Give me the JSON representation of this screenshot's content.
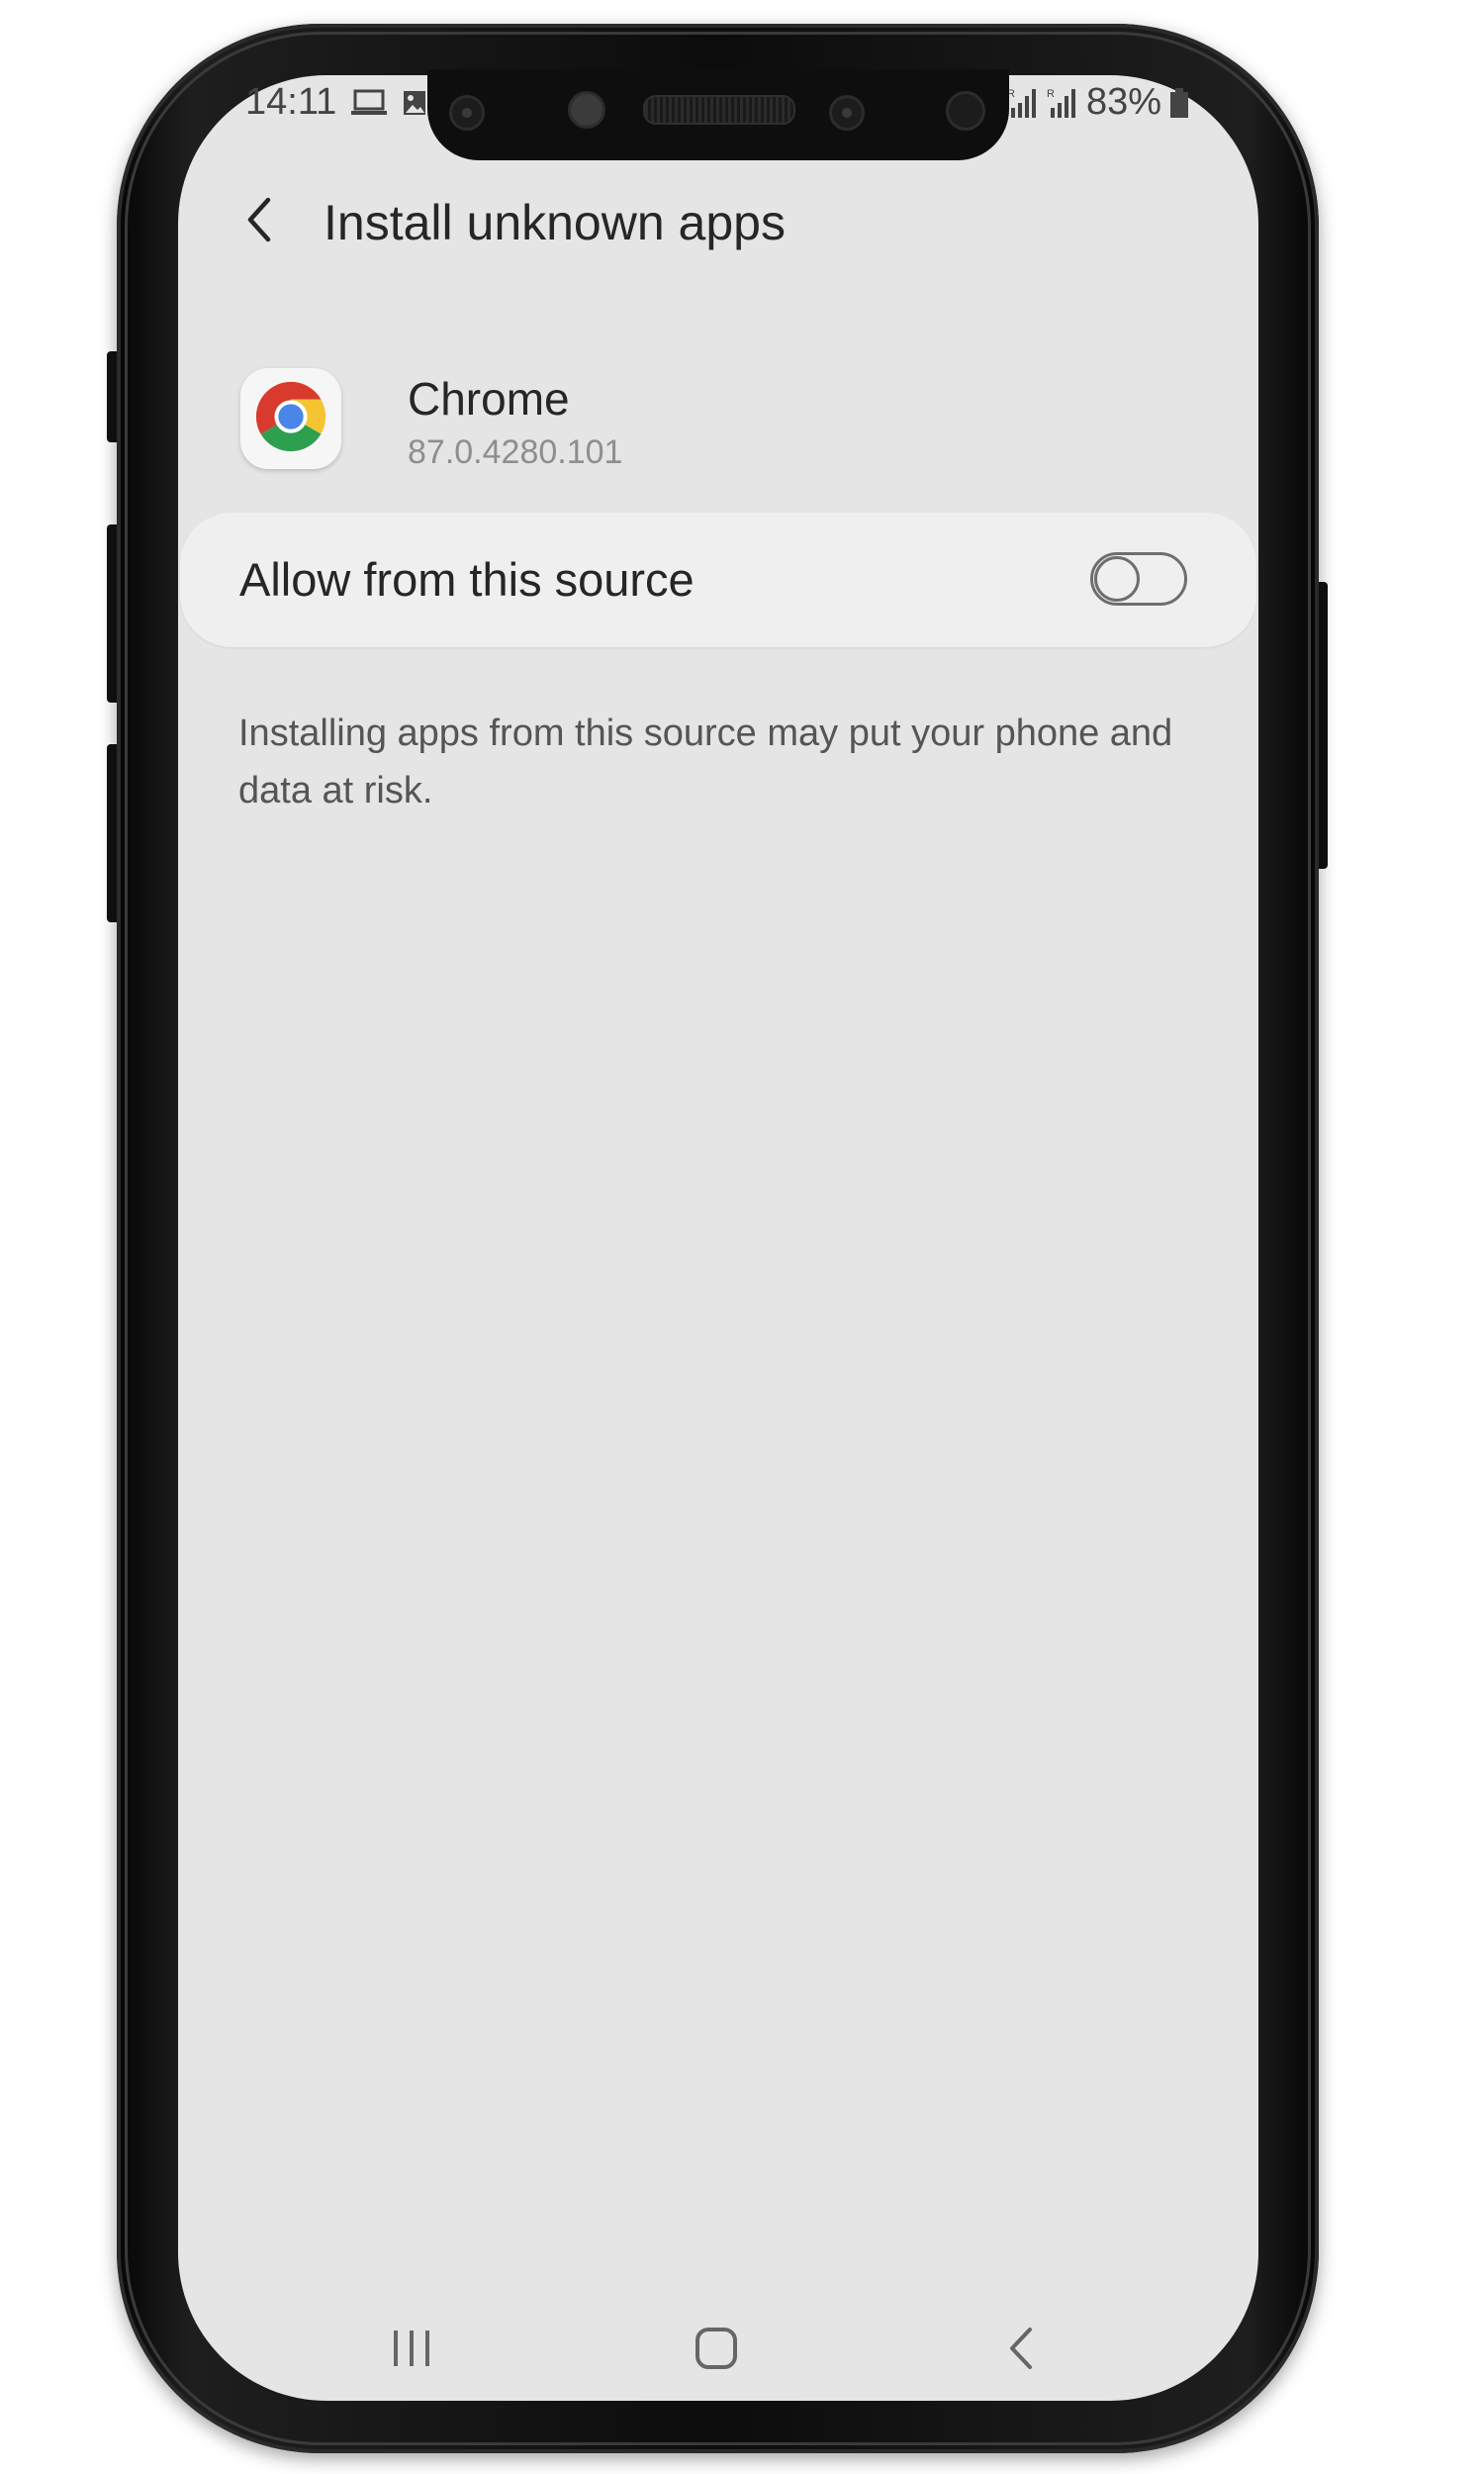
{
  "status_bar": {
    "time": "14:11",
    "battery": "83%",
    "icons": [
      "laptop-icon",
      "image-icon",
      "signal-icon",
      "signal-icon",
      "battery-icon"
    ]
  },
  "header": {
    "title": "Install unknown apps",
    "back_icon": "chevron-left-icon"
  },
  "app": {
    "name": "Chrome",
    "version": "87.0.4280.101",
    "icon": "chrome-icon"
  },
  "setting": {
    "label": "Allow from this source",
    "enabled": false
  },
  "warning_text": "Installing apps from this source may put your phone and data at risk.",
  "nav_bar": {
    "icons": [
      "recents-icon",
      "home-icon",
      "back-icon"
    ]
  },
  "colors": {
    "screen_bg": "#e5e5e5",
    "card_bg": "#efefef",
    "text_primary": "#262626",
    "text_secondary": "#8e8e8e",
    "phone_body": "#0c0c0c"
  }
}
